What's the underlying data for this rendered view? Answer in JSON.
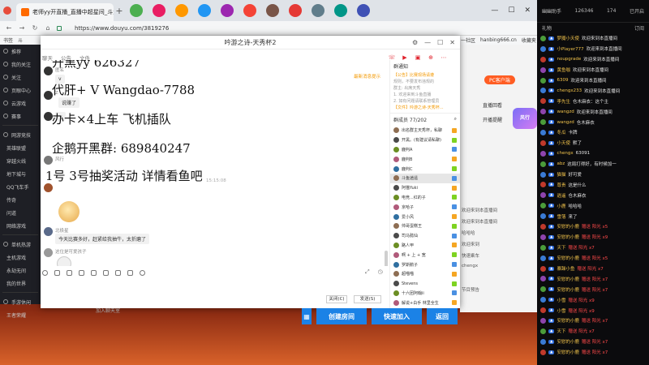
{
  "browser": {
    "tab_title": "老师yy开直播_直播中超星间_斗鱼直...",
    "url": "https://www.douyu.com/3819276",
    "bookmarks": [
      "书签",
      "斗"
    ],
    "bookmarks_right": [
      "一社区",
      "hanbing666.cn",
      "收藏夹"
    ]
  },
  "left_nav": {
    "items": [
      "推荐",
      "我的关注",
      "关注",
      "页眼中心",
      "云游戏",
      "赛事"
    ],
    "sections": [
      "网游竞技",
      "英雄联盟",
      "穿越火线",
      "地下城与",
      "QQ飞车手",
      "传奇",
      "问道",
      "网络游戏",
      "单机热游",
      "主机游戏",
      "永劫无间",
      "我的世界",
      "手游休闲",
      "王者荣耀"
    ]
  },
  "chat": {
    "window_title": "吟游之诗-天秀杯2",
    "tabs": [
      "聊天",
      "公告",
      "文件"
    ],
    "top_right_link": "最新消息提示",
    "timestamp": "15:15:08",
    "messages": [
      {
        "nick": "匿名",
        "bubble": "v"
      },
      {
        "nick": "Z",
        "bubble": "说赚了"
      },
      {
        "nick": "Z",
        "bubble": "~"
      },
      {
        "nick": "风行",
        "bubble": ""
      },
      {
        "nick": "北极星",
        "bubble": "今天比赛多好，赶紧给我抽牛，太折磨了"
      },
      {
        "nick": "这位是可爱孩子",
        "bubble": ""
      }
    ],
    "ad_lines": [
      "开黑yy   626327",
      "代肝+ V Wangdao-7788",
      "办卡×4上车 飞机插队",
      "企鹅开黑群: 689840247",
      "1号 3号抽奖活动 详情看鱼吧"
    ],
    "close_button": "关闭(C)",
    "send_button": "发送(S)"
  },
  "group_panel": {
    "title": "群通知",
    "notice_lines": [
      "【公告】比赛现场请遵",
      "规则，不要发布违规的",
      "群主: 出席天秀",
      "1. 欢迎来到斗鱼直播",
      "2. 如有问题请联系管理员",
      "【文件】吟游之诗-天秀杯..."
    ],
    "members_label": "群成员 77/202",
    "members": [
      "出名群主天秀杯，私聊",
      "开黑。(有建议请私聊)",
      "鹿判A",
      "鹿判B",
      "鹿判C",
      "斗鱼逍遥",
      "阿猫Yuki",
      "电竞...红的子",
      "京哈子",
      "爱小风",
      "帅哥蛋糕王",
      "司马懿仙",
      "路人甲",
      "啊 + 上 + 宽",
      "罗斯鹅子",
      "超喵喵",
      "Stevens",
      "十六团阿翰ii",
      "解说+白手 林里全生"
    ]
  },
  "page_right": {
    "pc_button": "PC客户端",
    "tabs": [
      "直播回看",
      "开播提醒"
    ],
    "badge": "风行",
    "rows": [
      "欢迎来到本直播间",
      "欢迎来到本直播间",
      "哈哈哈",
      "欢迎来到",
      "快速乘车",
      "chengx",
      "节目预告"
    ]
  },
  "room": {
    "input_placeholder": "加入聊天室",
    "create": "创建房间",
    "quick_join": "快速加入",
    "back": "返回"
  },
  "danmu": {
    "header_left": "幽幽助手",
    "header_mid": "126346",
    "header_count": "174",
    "header_right": "已开启",
    "sub_left": "礼物",
    "sub_right": "订阅",
    "rows": [
      {
        "name": "梦魇小天使",
        "text": "欢迎来到本直播间"
      },
      {
        "name": "小Player777",
        "text": "欢迎来到本直播间"
      },
      {
        "name": "noupgrade",
        "text": "欢迎来到本直播间"
      },
      {
        "name": "黄鱼咖",
        "text": "欢迎来到本直播间"
      },
      {
        "name": "6309",
        "text": "欢迎来到本直播间"
      },
      {
        "name": "chengx233",
        "text": "欢迎来到本直播间"
      },
      {
        "name": "李先生",
        "text": "仓木麻衣：这个主"
      },
      {
        "name": "wangzd",
        "text": "欢迎来到本直播间"
      },
      {
        "name": "wangzd",
        "text": "仓木麻衣"
      },
      {
        "name": "冬瓜",
        "text": "卡牌"
      },
      {
        "name": "小天使",
        "text": "默了"
      },
      {
        "name": "chengx",
        "text": "63091"
      },
      {
        "name": "abz",
        "text": "这局打得好，有时候加一"
      },
      {
        "name": "猫猫",
        "text": "好可爱"
      },
      {
        "name": "尊贵",
        "text": "这是什么"
      },
      {
        "name": "逍遥",
        "text": "仓木麻衣"
      },
      {
        "name": "小鹿",
        "text": "哈哈哈"
      },
      {
        "name": "雪落",
        "text": "来了"
      },
      {
        "name": "安慰的小鹿",
        "text": "赠送 阳光 x5"
      },
      {
        "name": "安慰的小鹿",
        "text": "赠送 阳光 x9"
      },
      {
        "name": "天下",
        "text": "赠送 阳光 x7"
      },
      {
        "name": "安慰的小鹿",
        "text": "赠送 阳光 x5"
      },
      {
        "name": "暴躁小鱼",
        "text": "赠送 阳光 x7"
      },
      {
        "name": "安慰的小鹿",
        "text": "赠送 阳光 x7"
      },
      {
        "name": "安慰的小鹿",
        "text": "赠送 阳光 x7"
      },
      {
        "name": "小雪",
        "text": "赠送 阳光 x9"
      },
      {
        "name": "小雪",
        "text": "赠送 阳光 x9"
      },
      {
        "name": "安慰的小鹿",
        "text": "赠送 阳光 x7"
      },
      {
        "name": "天下",
        "text": "赠送 阳光 x7"
      },
      {
        "name": "安慰的小鹿",
        "text": "赠送 阳光 x7"
      },
      {
        "name": "安慰的小鹿",
        "text": "赠送 阳光 x7"
      }
    ]
  }
}
